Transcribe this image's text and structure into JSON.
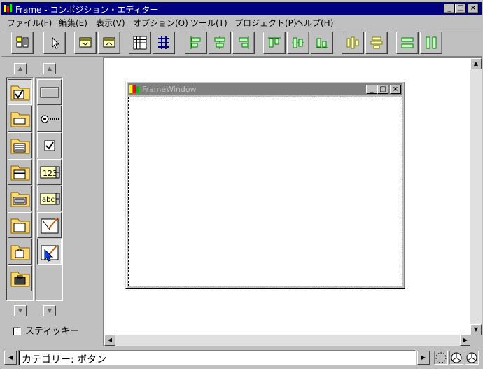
{
  "window": {
    "title": "Frame - コンポジション・エディター",
    "minimize": "_",
    "maximize": "□",
    "close": "×"
  },
  "menu": [
    {
      "label": "ファイル(F)"
    },
    {
      "label": "編集(E)"
    },
    {
      "label": "表示(V)"
    },
    {
      "label": "オプション(O)"
    },
    {
      "label": "ツール(T)"
    },
    {
      "label": "プロジェクト(P)"
    },
    {
      "label": "ヘルプ(H)"
    }
  ],
  "toolbar": {
    "icons": [
      "properties-icon",
      "pointer-icon",
      "copy-part-icon",
      "paste-part-icon",
      "grid-icon",
      "snap-to-grid-icon",
      "align-left-icon",
      "align-center-icon",
      "align-right-icon",
      "align-top-icon",
      "align-middle-icon",
      "align-bottom-icon",
      "distribute-horizontal-icon",
      "distribute-vertical-icon",
      "match-width-icon",
      "match-height-icon"
    ]
  },
  "palette": {
    "categories": [
      "button-category-icon",
      "data-entry-category-icon",
      "list-category-icon",
      "combo-category-icon",
      "canvas-category-icon",
      "frame-category-icon",
      "tool-category-icon",
      "other-category-icon"
    ],
    "parts": [
      "push-button-icon",
      "radio-button-icon",
      "check-box-icon",
      "numeric-spin-icon",
      "text-spin-icon",
      "form-icon",
      "selected-form-icon"
    ],
    "sticky_label": "スティッキー",
    "sticky_checked": false
  },
  "canvas": {
    "frame_window_title": "FrameWindow"
  },
  "status": {
    "text": "カテゴリー: ボタン"
  },
  "colors": {
    "title_active": "#000080",
    "title_inactive": "#808080",
    "face": "#c0c0c0"
  }
}
